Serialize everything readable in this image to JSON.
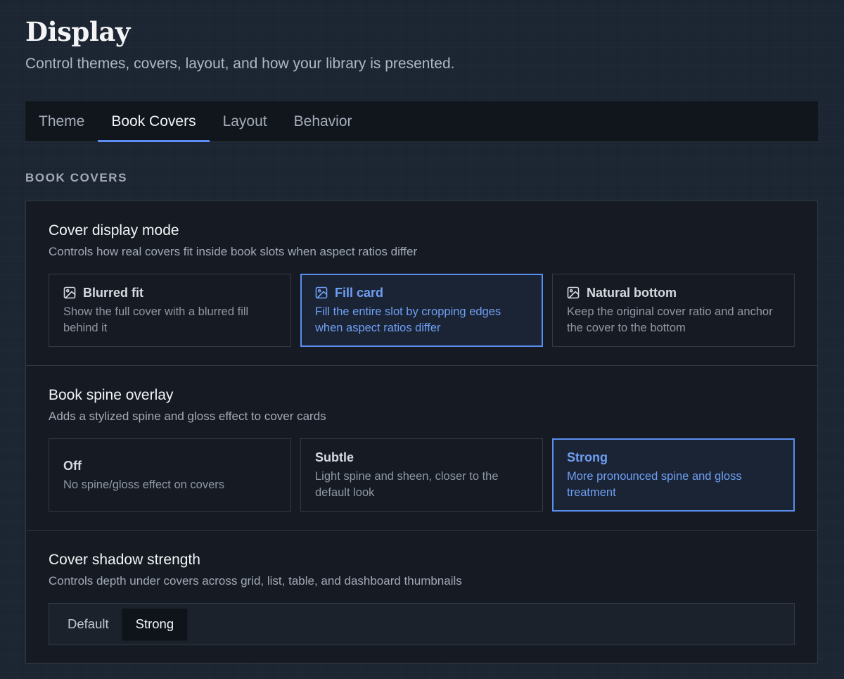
{
  "page": {
    "title": "Display",
    "subtitle": "Control themes, covers, layout, and how your library is presented."
  },
  "tabs": [
    {
      "label": "Theme",
      "active": false
    },
    {
      "label": "Book Covers",
      "active": true
    },
    {
      "label": "Layout",
      "active": false
    },
    {
      "label": "Behavior",
      "active": false
    }
  ],
  "section": {
    "heading": "BOOK COVERS"
  },
  "cover_display_mode": {
    "title": "Cover display mode",
    "description": "Controls how real covers fit inside book slots when aspect ratios differ",
    "selected": "Fill card",
    "options": [
      {
        "label": "Blurred fit",
        "description": "Show the full cover with a blurred fill behind it",
        "icon": "image-icon"
      },
      {
        "label": "Fill card",
        "description": "Fill the entire slot by cropping edges when aspect ratios differ",
        "icon": "image-icon"
      },
      {
        "label": "Natural bottom",
        "description": "Keep the original cover ratio and anchor the cover to the bottom",
        "icon": "image-icon"
      }
    ]
  },
  "book_spine_overlay": {
    "title": "Book spine overlay",
    "description": "Adds a stylized spine and gloss effect to cover cards",
    "selected": "Strong",
    "options": [
      {
        "label": "Off",
        "description": "No spine/gloss effect on covers"
      },
      {
        "label": "Subtle",
        "description": "Light spine and sheen, closer to the default look"
      },
      {
        "label": "Strong",
        "description": "More pronounced spine and gloss treatment"
      }
    ]
  },
  "cover_shadow_strength": {
    "title": "Cover shadow strength",
    "description": "Controls depth under covers across grid, list, table, and dashboard thumbnails",
    "selected": "Strong",
    "options": [
      "Default",
      "Strong"
    ]
  },
  "colors": {
    "accent": "#5b8ef0",
    "accent_text": "#6f9ff5",
    "background": "#1c2633",
    "panel": "#161b23",
    "border": "#303845"
  }
}
